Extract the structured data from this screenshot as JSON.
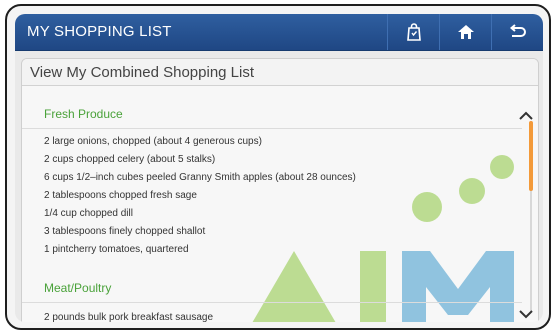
{
  "app": {
    "title": "MY SHOPPING LIST"
  },
  "header": {
    "buttons": [
      {
        "icon": "shopping-bag-icon"
      },
      {
        "icon": "home-icon"
      },
      {
        "icon": "back-arrow-icon"
      }
    ]
  },
  "panel": {
    "title": "View My Combined Shopping List",
    "sections": [
      {
        "label": "Fresh Produce",
        "items": [
          "2 large onions, chopped (about 4 generous cups)",
          "2 cups chopped celery (about 5 stalks)",
          "6 cups 1/2–inch cubes peeled Granny Smith apples (about 28 ounces)",
          "2 tablespoons chopped fresh sage",
          "1/4 cup chopped dill",
          "3 tablespoons finely chopped shallot",
          "1 pintcherry tomatoes, quartered"
        ]
      },
      {
        "label": "Meat/Poultry",
        "items": [
          "2 pounds bulk pork breakfast sausage"
        ]
      }
    ]
  },
  "watermark": {
    "text": "AiM"
  },
  "colors": {
    "header": "#2a579a",
    "section_label": "#4aa23a",
    "scroll_thumb": "#f39a3a"
  }
}
